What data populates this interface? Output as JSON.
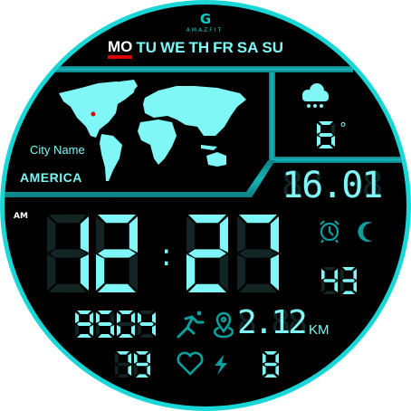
{
  "brand": {
    "logo_letter": "G",
    "name": "AMAZFIT"
  },
  "days": [
    {
      "label": "MO",
      "active": true
    },
    {
      "label": "TU",
      "active": false
    },
    {
      "label": "WE",
      "active": false
    },
    {
      "label": "TH",
      "active": false
    },
    {
      "label": "FR",
      "active": false
    },
    {
      "label": "SA",
      "active": false
    },
    {
      "label": "SU",
      "active": false
    }
  ],
  "world": {
    "city_label": "City Name",
    "region": "AMERICA"
  },
  "weather": {
    "icon": "snow-cloud-icon",
    "temperature": "6",
    "unit": "°"
  },
  "date": "16.01",
  "time": {
    "ampm": "AM",
    "hours": "12",
    "minutes": "27",
    "separator": ":",
    "seconds": "43"
  },
  "status_icons": [
    "alarm-icon",
    "moon-icon"
  ],
  "activity": {
    "steps": "9504",
    "distance": "2.12",
    "distance_unit": "KM",
    "heart_rate": "79",
    "battery": "8"
  },
  "colors": {
    "accent": "#7ff7f7",
    "frame": "#14c8c8",
    "icon": "#0aa0a0",
    "ghost": "#132424",
    "active_day": "#e00000",
    "ring": "#1ad6d6"
  }
}
